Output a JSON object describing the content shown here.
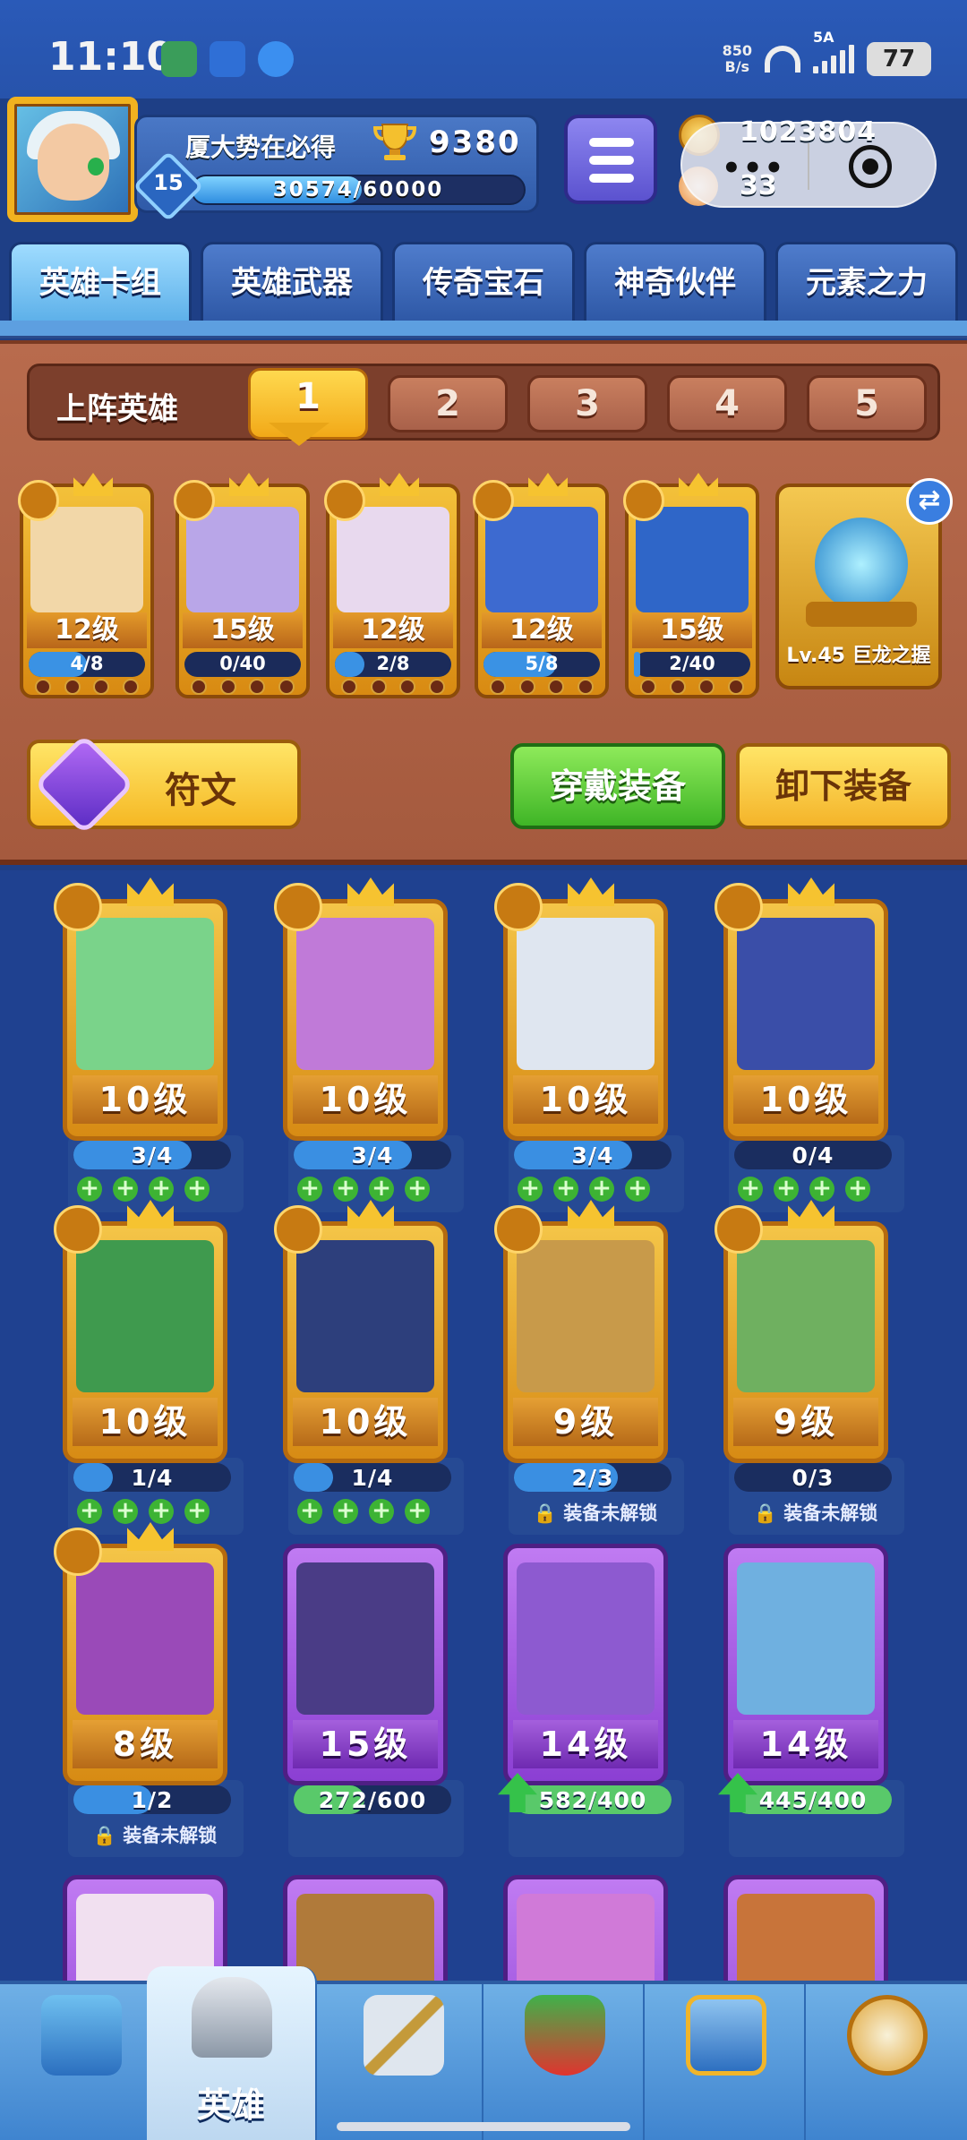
{
  "status_bar": {
    "time": "11:10",
    "net_speed_value": "850",
    "net_speed_unit": "B/s",
    "network": "5A",
    "battery": "77"
  },
  "player": {
    "name": "厦大势在必得",
    "trophies": "9380",
    "level": "15",
    "exp_text": "30574/60000",
    "exp_fraction": 0.51,
    "gold": "1023804",
    "gems": "33"
  },
  "capsule": {
    "dots": "•••"
  },
  "tabs": [
    {
      "label": "英雄卡组",
      "active": true
    },
    {
      "label": "英雄武器",
      "active": false
    },
    {
      "label": "传奇宝石",
      "active": false
    },
    {
      "label": "神奇伙伴",
      "active": false
    },
    {
      "label": "元素之力",
      "active": false
    }
  ],
  "lineup": {
    "label": "上阵英雄",
    "slots": [
      "1",
      "2",
      "3",
      "4",
      "5"
    ],
    "active_slot": "1"
  },
  "equipped_heroes": [
    {
      "level": "12级",
      "progress": "4/8",
      "fraction": 0.5,
      "color": "#f2d7a8"
    },
    {
      "level": "15级",
      "progress": "0/40",
      "fraction": 0.0,
      "color": "#b9a6e8"
    },
    {
      "level": "12级",
      "progress": "2/8",
      "fraction": 0.25,
      "color": "#e8d9ee"
    },
    {
      "level": "12级",
      "progress": "5/8",
      "fraction": 0.62,
      "color": "#3d6ad0"
    },
    {
      "level": "15级",
      "progress": "2/40",
      "fraction": 0.05,
      "color": "#2f66c8"
    }
  ],
  "relic": {
    "label": "Lv.45 巨龙之握"
  },
  "buttons": {
    "rune": "符文",
    "equip": "穿戴装备",
    "unequip": "卸下装备"
  },
  "heroes": [
    {
      "level": "10级",
      "progress": "3/4",
      "fraction": 0.75,
      "status": "pluses",
      "card": "gold",
      "color": "#7ad38a"
    },
    {
      "level": "10级",
      "progress": "3/4",
      "fraction": 0.75,
      "status": "pluses",
      "card": "gold",
      "color": "#c07ad8"
    },
    {
      "level": "10级",
      "progress": "3/4",
      "fraction": 0.75,
      "status": "pluses",
      "card": "gold",
      "color": "#dfe6f0"
    },
    {
      "level": "10级",
      "progress": "0/4",
      "fraction": 0.0,
      "status": "pluses",
      "card": "gold",
      "color": "#3a4ea8"
    },
    {
      "level": "10级",
      "progress": "1/4",
      "fraction": 0.25,
      "status": "pluses",
      "card": "gold",
      "color": "#3f9a4e"
    },
    {
      "level": "10级",
      "progress": "1/4",
      "fraction": 0.25,
      "status": "pluses",
      "card": "gold",
      "color": "#2d3f7c"
    },
    {
      "level": "9级",
      "progress": "2/3",
      "fraction": 0.66,
      "status": "locked",
      "card": "gold",
      "color": "#c89a4a"
    },
    {
      "level": "9级",
      "progress": "0/3",
      "fraction": 0.0,
      "status": "locked",
      "card": "gold",
      "color": "#6fb060"
    },
    {
      "level": "8级",
      "progress": "1/2",
      "fraction": 0.5,
      "status": "locked",
      "card": "gold",
      "color": "#9a4ab8"
    },
    {
      "level": "15级",
      "progress": "272/600",
      "fraction": 0.45,
      "status": "none",
      "card": "purple",
      "color": "#4a3c86"
    },
    {
      "level": "14级",
      "progress": "582/400",
      "fraction": 1.0,
      "status": "up",
      "card": "purple",
      "color": "#8d5ad0"
    },
    {
      "level": "14级",
      "progress": "445/400",
      "fraction": 1.0,
      "status": "up",
      "card": "purple",
      "color": "#6fb0e0"
    },
    {
      "level": "",
      "progress": "",
      "fraction": 0.0,
      "status": "none",
      "card": "purple",
      "color": "#f1e0f0"
    },
    {
      "level": "",
      "progress": "",
      "fraction": 0.0,
      "status": "none",
      "card": "purple",
      "color": "#b07a3a"
    },
    {
      "level": "",
      "progress": "",
      "fraction": 0.0,
      "status": "none",
      "card": "purple",
      "color": "#d07ad8"
    },
    {
      "level": "",
      "progress": "",
      "fraction": 0.0,
      "status": "none",
      "card": "purple",
      "color": "#c8743a"
    }
  ],
  "locked_text": "装备未解锁",
  "plus_glyph": "+",
  "bottom_nav": [
    {
      "icon": "treasure-chest-icon",
      "label": ""
    },
    {
      "icon": "knight-helmet-icon",
      "label": "英雄",
      "active": true
    },
    {
      "icon": "crossed-swords-icon",
      "label": ""
    },
    {
      "icon": "crown-shield-icon",
      "label": ""
    },
    {
      "icon": "team-banner-icon",
      "label": ""
    },
    {
      "icon": "compass-icon",
      "label": ""
    }
  ],
  "colors": {
    "background": "#1e3f86",
    "wood": "#b86b4d",
    "gold": "#f2a918",
    "green": "#3fb526"
  }
}
